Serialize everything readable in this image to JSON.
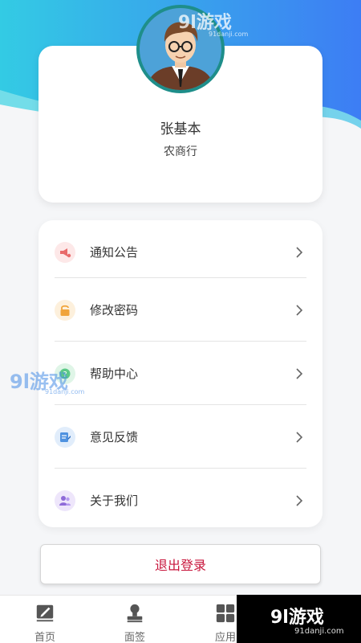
{
  "profile": {
    "name": "张基本",
    "organization": "农商行"
  },
  "menu": {
    "items": [
      {
        "label": "通知公告",
        "icon": "megaphone-icon",
        "color": "#f3a0a0"
      },
      {
        "label": "修改密码",
        "icon": "lock-icon",
        "color": "#f3b96a"
      },
      {
        "label": "帮助中心",
        "icon": "help-icon",
        "color": "#7fd6a0"
      },
      {
        "label": "意见反馈",
        "icon": "feedback-icon",
        "color": "#6aa6e8"
      },
      {
        "label": "关于我们",
        "icon": "people-icon",
        "color": "#a58ae6"
      }
    ]
  },
  "logout_label": "退出登录",
  "tabbar": {
    "tabs": [
      {
        "label": "首页",
        "icon": "edit-icon"
      },
      {
        "label": "面签",
        "icon": "stamp-icon"
      },
      {
        "label": "应用",
        "icon": "apps-grid-icon"
      }
    ]
  },
  "watermark": {
    "brand": "9l游戏",
    "domain": "91danji.com"
  },
  "colors": {
    "header_gradient_start": "#35c8e6",
    "header_gradient_end": "#3a7ef5",
    "logout_text": "#c8163c",
    "avatar_ring": "#1e8e8a"
  }
}
